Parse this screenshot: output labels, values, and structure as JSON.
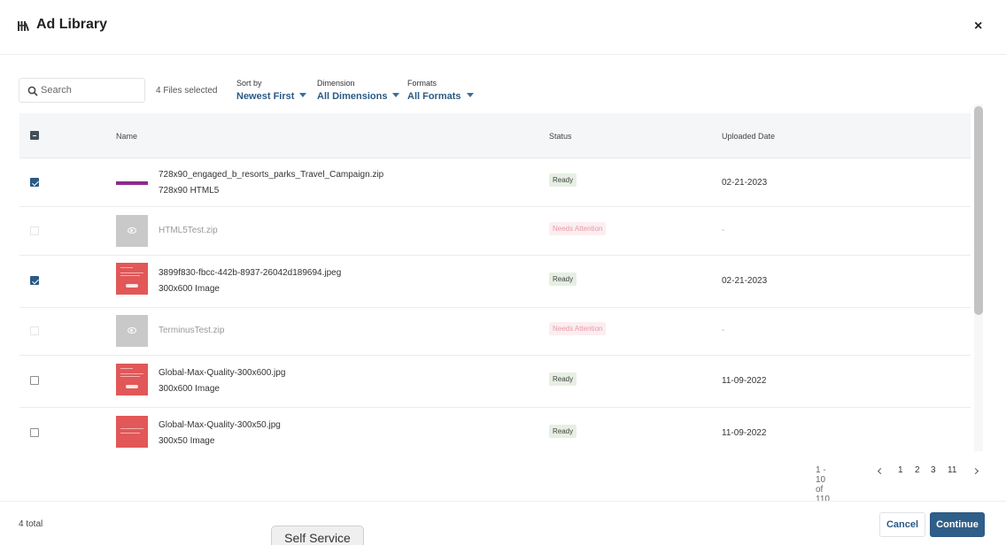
{
  "header": {
    "title": "Ad Library",
    "close_label": "×"
  },
  "toolbar": {
    "search_placeholder": "Search",
    "files_selected": "4 Files selected",
    "sort": {
      "label": "Sort by",
      "value": "Newest First"
    },
    "dimension": {
      "label": "Dimension",
      "value": "All Dimensions"
    },
    "formats": {
      "label": "Formats",
      "value": "All Formats"
    }
  },
  "table": {
    "columns": {
      "name": "Name",
      "status": "Status",
      "uploaded": "Uploaded Date"
    },
    "rows": [
      {
        "name": "728x90_engaged_b_resorts_parks_Travel_Campaign.zip",
        "subtitle": "728x90 HTML5",
        "status": "Ready",
        "date": "02-21-2023",
        "checked": true,
        "thumbnail": "purple-banner"
      },
      {
        "name": "HTML5Test.zip",
        "subtitle": "",
        "status": "Needs Attention",
        "date": "-",
        "checked": false,
        "thumbnail": "eye-icon"
      },
      {
        "name": "3899f830-fbcc-442b-8937-26042d189694.jpeg",
        "subtitle": "300x600 Image",
        "status": "Ready",
        "date": "02-21-2023",
        "checked": true,
        "thumbnail": "red-ad"
      },
      {
        "name": "TerminusTest.zip",
        "subtitle": "",
        "status": "Needs Attention",
        "date": "-",
        "checked": false,
        "thumbnail": "eye-icon"
      },
      {
        "name": "Global-Max-Quality-300x600.jpg",
        "subtitle": "300x600 Image",
        "status": "Ready",
        "date": "11-09-2022",
        "checked": false,
        "thumbnail": "red-ad"
      },
      {
        "name": "Global-Max-Quality-300x50.jpg",
        "subtitle": "300x50 Image",
        "status": "Ready",
        "date": "11-09-2022",
        "checked": false,
        "thumbnail": "red-ad"
      }
    ]
  },
  "pagination": {
    "range": "1 - 10 of 110",
    "pages": [
      "1",
      "2",
      "3",
      "11"
    ]
  },
  "footer": {
    "total": "4 total",
    "cancel_label": "Cancel",
    "continue_label": "Continue"
  },
  "taskbar": {
    "self_service": "Self Service"
  },
  "colors": {
    "accent": "#2a5a85",
    "ready_badge": "#e6efe2",
    "attention_badge": "#fbeef0"
  }
}
